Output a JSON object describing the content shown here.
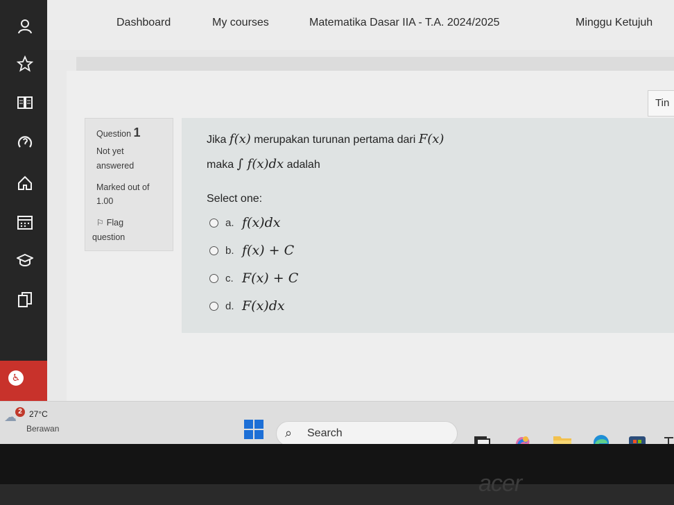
{
  "nav": {
    "items": [
      "Dashboard",
      "My courses",
      "Matematika Dasar IIA - T.A. 2024/2025",
      "Minggu Ketujuh"
    ]
  },
  "sidebar": {
    "icons": [
      "user-icon",
      "star-icon",
      "book-icon",
      "help-icon",
      "home-icon",
      "calendar-icon",
      "graduation-cap-icon",
      "copy-icon"
    ],
    "accessibility_icon": "accessibility-icon"
  },
  "timer": {
    "label": "Tin"
  },
  "question_info": {
    "question_label": "Question",
    "question_number": "1",
    "state_line1": "Not yet",
    "state_line2": "answered",
    "marked_line1": "Marked out of",
    "marked_line2": "1.00",
    "flag_line1": "Flag",
    "flag_line2": "question"
  },
  "question": {
    "line1_prefix": "Jika",
    "line1_math1": "f(x)",
    "line1_mid": "merupakan turunan pertama dari",
    "line1_math2": "F(x)",
    "line2_prefix": "maka",
    "line2_math": "∫ f(x)dx",
    "line2_suffix": "adalah",
    "prompt": "Select one:",
    "options": [
      {
        "letter": "a.",
        "math": "f(x)dx"
      },
      {
        "letter": "b.",
        "math": "f(x) + C"
      },
      {
        "letter": "c.",
        "math": "F(x) + C"
      },
      {
        "letter": "d.",
        "math": "F(x)dx"
      }
    ]
  },
  "taskbar": {
    "weather_badge": "2",
    "temperature": "27°C",
    "weather_desc": "Berawan",
    "search_label": "Search",
    "accent": "#1d6fd6"
  },
  "bezel": {
    "brand": "acer"
  }
}
